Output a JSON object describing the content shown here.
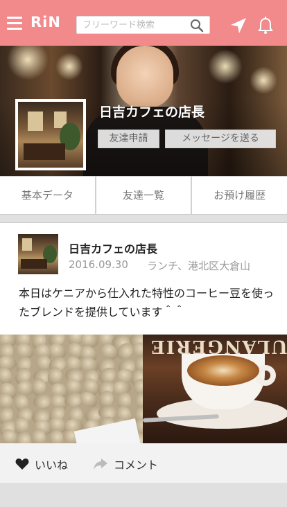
{
  "header": {
    "logo": "RiN",
    "search_placeholder": "フリーワード検索"
  },
  "profile": {
    "name": "日吉カフェの店長",
    "friend_request_label": "友達申請",
    "send_message_label": "メッセージを送る"
  },
  "tabs": [
    {
      "label": "基本データ"
    },
    {
      "label": "友達一覧"
    },
    {
      "label": "お預け履歴"
    }
  ],
  "post": {
    "author": "日吉カフェの店長",
    "date": "2016.09.30",
    "meta": "ランチ、港北区大倉山",
    "body": "本日はケニアから仕入れた特性のコーヒー豆を使ったブレンドを提供しています＾＾",
    "like_label": "いいね",
    "comment_label": "コメント",
    "latte_shop_text": "BOULANGERIE"
  },
  "colors": {
    "header_bg": "#f2898b",
    "text_muted": "#999999"
  }
}
